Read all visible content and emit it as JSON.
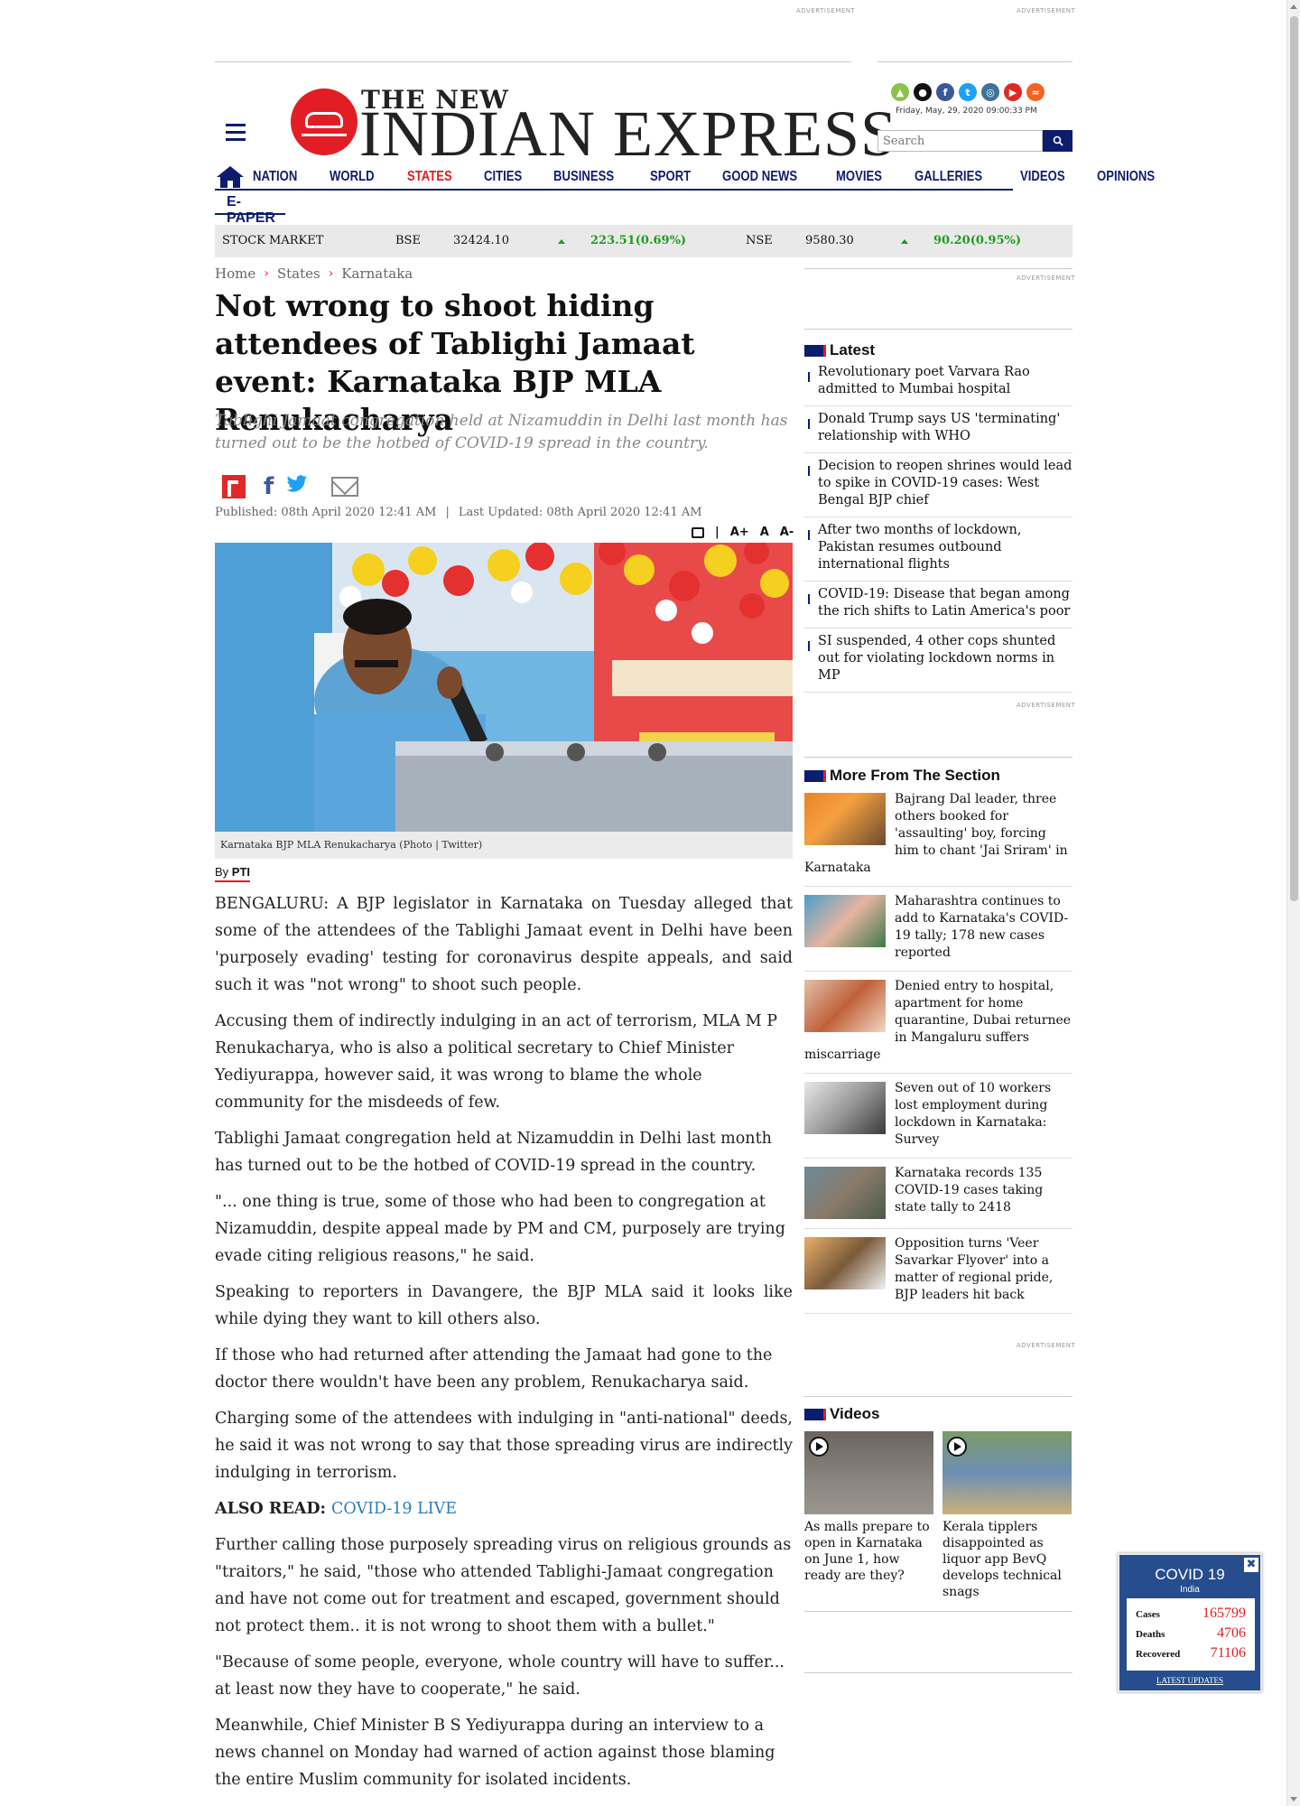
{
  "ads": {
    "label": "ADVERTISEMENT"
  },
  "header": {
    "logo_line1": "THE NEW",
    "logo_line2": "INDIAN EXPRESS",
    "date": "Friday, May, 29, 2020   09:00:33 PM",
    "search_placeholder": "Search",
    "social": [
      {
        "icon": "android-icon",
        "color": "#8bc34a"
      },
      {
        "icon": "apple-icon",
        "color": "#111111"
      },
      {
        "icon": "facebook-icon",
        "color": "#3b5998"
      },
      {
        "icon": "twitter-icon",
        "color": "#1da1f2"
      },
      {
        "icon": "instagram-icon",
        "color": "#3f729b"
      },
      {
        "icon": "youtube-icon",
        "color": "#e02a20"
      },
      {
        "icon": "rss-icon",
        "color": "#f26522"
      }
    ]
  },
  "nav": {
    "items": [
      "NATION",
      "WORLD",
      "STATES",
      "CITIES",
      "BUSINESS",
      "SPORT",
      "GOOD NEWS",
      "MOVIES",
      "GALLERIES",
      "VIDEOS",
      "OPINIONS"
    ],
    "active": "STATES",
    "epaper": "E-PAPER"
  },
  "stock": {
    "label": "STOCK MARKET",
    "bse_label": "BSE",
    "bse_value": "32424.10",
    "bse_change": "223.51(0.69%)",
    "nse_label": "NSE",
    "nse_value": "9580.30",
    "nse_change": "90.20(0.95%)"
  },
  "breadcrumb": [
    "Home",
    "States",
    "Karnataka"
  ],
  "article": {
    "title": "Not wrong to shoot hiding attendees of Tablighi Jamaat event: Karnataka BJP MLA Renukacharya",
    "subtitle": "Tablighi Jamaat congregation held at Nizamuddin in Delhi last month has turned out to be the hotbed of COVID-19 spread in the country.",
    "published": "Published: 08th April 2020 12:41 AM",
    "updated": "Last Updated: 08th April 2020 12:41 AM",
    "tools": {
      "sep": "|",
      "font_up": "A+",
      "font_reset": "A",
      "font_down": "A-"
    },
    "caption": "Karnataka BJP MLA Renukacharya (Photo | Twitter)",
    "byline_prefix": "By",
    "byline_author": "PTI",
    "paragraphs": [
      "BENGALURU: A BJP legislator in Karnataka on Tuesday alleged that some of the attendees of the Tablighi Jamaat event in Delhi have been 'purposely evading' testing for coronavirus despite appeals, and said such it was \"not wrong\" to shoot such people.",
      "Accusing them of indirectly indulging in an act of terrorism, MLA M P Renukacharya, who is also a political secretary to Chief Minister Yediyurappa, however said, it was wrong to blame the whole community for the misdeeds of few.",
      "Tablighi Jamaat congregation held at Nizamuddin in Delhi last month has turned out to be the hotbed of COVID-19 spread in the country.",
      "\"... one thing is true, some of those who had been to congregation at Nizamuddin, despite appeal made by PM and CM, purposely are trying evade citing religious reasons,\" he said.",
      "Speaking to reporters in Davangere, the BJP MLA said it looks like while dying they want to kill others also.",
      "If those who had returned after attending the Jamaat had gone to the doctor there wouldn't have been any problem, Renukacharya said.",
      "Charging some of the attendees with indulging in \"anti-national\" deeds, he said it was not wrong to say that those spreading virus are indirectly indulging in terrorism."
    ],
    "also_read_label": "ALSO READ:",
    "also_read_link": "COVID-19 LIVE",
    "paragraphs_after": [
      "Further calling those purposely spreading virus on religious grounds as \"traitors,\" he said, \"those who attended Tablighi-Jamaat congregation and have not come out for treatment and escaped, government should not protect them.. it is not wrong to shoot them with a bullet.\"",
      "\"Because of some people, everyone, whole country will have to suffer... at least now they have to cooperate,\" he said.",
      "Meanwhile, Chief Minister B S Yediyurappa during an interview to a news channel on Monday had warned of action against those blaming the entire Muslim community for isolated incidents."
    ]
  },
  "sidebar": {
    "latest_title": "Latest",
    "latest": [
      "Revolutionary poet Varvara Rao admitted to Mumbai hospital",
      "Donald Trump says US 'terminating' relationship with WHO",
      "Decision to reopen shrines would lead to spike in COVID-19 cases: West Bengal BJP chief",
      "After two months of lockdown, Pakistan resumes outbound international flights",
      "COVID-19: Disease that began among the rich shifts to Latin America's poor",
      "SI suspended, 4 other cops shunted out for violating lockdown norms in MP"
    ],
    "more_title": "More From The Section",
    "more": [
      "Bajrang Dal leader, three others booked for 'assaulting' boy, forcing him to chant 'Jai Sriram' in Karnataka",
      "Maharashtra continues to add to Karnataka's COVID-19 tally; 178 new cases reported",
      "Denied entry to hospital, apartment for home quarantine, Dubai returnee in Mangaluru suffers miscarriage",
      "Seven out of 10 workers lost employment during lockdown in Karnataka: Survey",
      "Karnataka records 135 COVID-19 cases taking state tally to 2418",
      "Opposition turns 'Veer Savarkar Flyover' into a matter of regional pride, BJP leaders hit back"
    ],
    "videos_title": "Videos",
    "videos": [
      "As malls prepare to open in Karnataka on June 1, how ready are they?",
      "Kerala tipplers disappointed as liquor app BevQ develops technical snags"
    ]
  },
  "covid": {
    "title": "COVID 19",
    "region": "India",
    "close": "✖",
    "cases_label": "Cases",
    "cases": "165799",
    "deaths_label": "Deaths",
    "deaths": "4706",
    "recovered_label": "Recovered",
    "recovered": "71106",
    "updates": "LATEST UPDATES"
  }
}
